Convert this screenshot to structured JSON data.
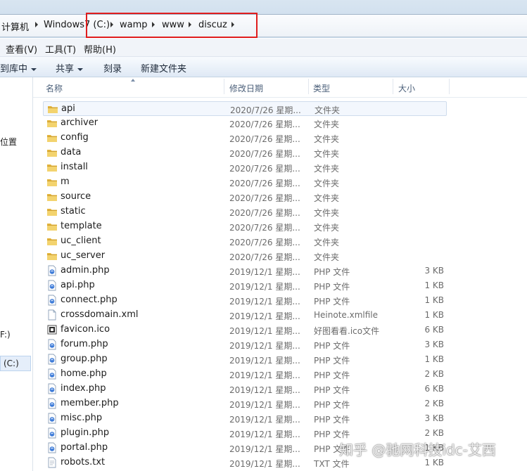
{
  "address": {
    "crumbs": [
      "计算机",
      "Windows7 (C:)",
      "wamp",
      "www",
      "discuz"
    ]
  },
  "menu": [
    "查看(V)",
    "工具(T)",
    "帮助(H)"
  ],
  "commands": {
    "include_library": "到库中",
    "share": "共享",
    "burn": "刻录",
    "new_folder": "新建文件夹"
  },
  "nav": {
    "location_label": "位置",
    "drive_c": "(C:)",
    "drive_f": "F:)"
  },
  "columns": {
    "name": "名称",
    "modified": "修改日期",
    "type": "类型",
    "size": "大小"
  },
  "files": [
    {
      "name": "api",
      "date": "2020/7/26 星期...",
      "type": "文件夹",
      "size": "",
      "icon": "folder-icon"
    },
    {
      "name": "archiver",
      "date": "2020/7/26 星期...",
      "type": "文件夹",
      "size": "",
      "icon": "folder-icon"
    },
    {
      "name": "config",
      "date": "2020/7/26 星期...",
      "type": "文件夹",
      "size": "",
      "icon": "folder-icon"
    },
    {
      "name": "data",
      "date": "2020/7/26 星期...",
      "type": "文件夹",
      "size": "",
      "icon": "folder-icon"
    },
    {
      "name": "install",
      "date": "2020/7/26 星期...",
      "type": "文件夹",
      "size": "",
      "icon": "folder-icon"
    },
    {
      "name": "m",
      "date": "2020/7/26 星期...",
      "type": "文件夹",
      "size": "",
      "icon": "folder-icon"
    },
    {
      "name": "source",
      "date": "2020/7/26 星期...",
      "type": "文件夹",
      "size": "",
      "icon": "folder-icon"
    },
    {
      "name": "static",
      "date": "2020/7/26 星期...",
      "type": "文件夹",
      "size": "",
      "icon": "folder-icon"
    },
    {
      "name": "template",
      "date": "2020/7/26 星期...",
      "type": "文件夹",
      "size": "",
      "icon": "folder-icon"
    },
    {
      "name": "uc_client",
      "date": "2020/7/26 星期...",
      "type": "文件夹",
      "size": "",
      "icon": "folder-icon"
    },
    {
      "name": "uc_server",
      "date": "2020/7/26 星期...",
      "type": "文件夹",
      "size": "",
      "icon": "folder-icon"
    },
    {
      "name": "admin.php",
      "date": "2019/12/1 星期...",
      "type": "PHP 文件",
      "size": "3 KB",
      "icon": "php-file-icon"
    },
    {
      "name": "api.php",
      "date": "2019/12/1 星期...",
      "type": "PHP 文件",
      "size": "1 KB",
      "icon": "php-file-icon"
    },
    {
      "name": "connect.php",
      "date": "2019/12/1 星期...",
      "type": "PHP 文件",
      "size": "1 KB",
      "icon": "php-file-icon"
    },
    {
      "name": "crossdomain.xml",
      "date": "2019/12/1 星期...",
      "type": "Heinote.xmlfile",
      "size": "1 KB",
      "icon": "xml-file-icon"
    },
    {
      "name": "favicon.ico",
      "date": "2019/12/1 星期...",
      "type": "好图看看.ico文件",
      "size": "6 KB",
      "icon": "ico-file-icon"
    },
    {
      "name": "forum.php",
      "date": "2019/12/1 星期...",
      "type": "PHP 文件",
      "size": "3 KB",
      "icon": "php-file-icon"
    },
    {
      "name": "group.php",
      "date": "2019/12/1 星期...",
      "type": "PHP 文件",
      "size": "1 KB",
      "icon": "php-file-icon"
    },
    {
      "name": "home.php",
      "date": "2019/12/1 星期...",
      "type": "PHP 文件",
      "size": "2 KB",
      "icon": "php-file-icon"
    },
    {
      "name": "index.php",
      "date": "2019/12/1 星期...",
      "type": "PHP 文件",
      "size": "6 KB",
      "icon": "php-file-icon"
    },
    {
      "name": "member.php",
      "date": "2019/12/1 星期...",
      "type": "PHP 文件",
      "size": "2 KB",
      "icon": "php-file-icon"
    },
    {
      "name": "misc.php",
      "date": "2019/12/1 星期...",
      "type": "PHP 文件",
      "size": "3 KB",
      "icon": "php-file-icon"
    },
    {
      "name": "plugin.php",
      "date": "2019/12/1 星期...",
      "type": "PHP 文件",
      "size": "2 KB",
      "icon": "php-file-icon"
    },
    {
      "name": "portal.php",
      "date": "2019/12/1 星期...",
      "type": "PHP 文件",
      "size": "1 KB",
      "icon": "php-file-icon"
    },
    {
      "name": "robots.txt",
      "date": "2019/12/1 星期...",
      "type": "TXT 文件",
      "size": "1 KB",
      "icon": "txt-file-icon"
    }
  ],
  "watermark": "知乎 @驰网科技idc-艾西",
  "colors": {
    "highlight_box": "#e01d1d",
    "folder_yellow": "#e8bf4a"
  }
}
